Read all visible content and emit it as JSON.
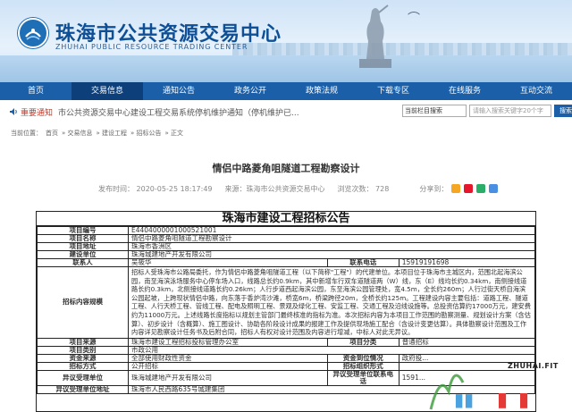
{
  "header": {
    "title": "珠海市公共资源交易中心",
    "subtitle": "ZHUHAI PUBLIC RESOURCE TRADING CENTER"
  },
  "nav": {
    "items": [
      "首页",
      "交易信息",
      "通知公告",
      "政务公开",
      "政策法规",
      "下载专区",
      "在线服务",
      "互动交流"
    ],
    "active_index": 1
  },
  "notice": {
    "label": "重要通知",
    "text": "市公共资源交易中心建设工程交易系统停机维护通知（停机维护已..."
  },
  "search": {
    "select_value": "当前栏目搜索",
    "placeholder": "请输入搜索关键字20个字",
    "button": "搜索"
  },
  "breadcrumb": [
    "当前位置：",
    "首页",
    "» 交易信息",
    "» 建设工程",
    "» 招标公告",
    "» 正文"
  ],
  "article": {
    "title": "情侣中路菱角咀隧道工程勘察设计",
    "published": "发布时间： 2020-05-25 18:17:49",
    "source": "来源：珠海市公共资源交易中心",
    "views": "浏览次数： 728",
    "share_label": "分享到："
  },
  "doc": {
    "title": "珠海市建设工程招标公告",
    "rows": [
      {
        "label": "项目编号",
        "value": "E4404000001000521001"
      },
      {
        "label": "项目名称",
        "value": "情侣中路菱角咀隧道工程勘察设计"
      },
      {
        "label": "项目地址",
        "value": "珠海市香洲区"
      },
      {
        "label": "建设单位",
        "value": "珠海城建地产开发有限公司"
      }
    ],
    "contact": {
      "label": "联系人",
      "value": "吴筱华",
      "phone_label": "联系电话",
      "phone": "15919191698"
    },
    "overview_label": "招标内容规模",
    "overview": "招标人受珠海市公路局委托，作为情侣中路菱角咀隧道工程（以下简称\"工程\"）的代建单位。本项目位于珠海市主城区内，范围北起海滨公园，南至海滨泳场服务中心停车场入口，线路总长约0.9km，其中新增车行双车道隧道两（W）线，东（E）线均长约0.34km，南侧接线道路长约0.3km，北侧接线道路长约0.26km；人行步道西起海滨公园，东至海滨公园管理处，宽4.5m，全长约260m；人行过街天桥自海滨公园起坡，上跨现状情侣中路，向东落于香炉湾沙滩，桥宽6m，桥梁跨径20m，全桥长约125m。工程建设内容主要包括：道路工程、隧道工程、人行天桥工程、管线工程、配电及照明工程、景观及绿化工程、安监工程、交通工程及沿线设施等。总投资估算约17000万元，建安费约为11000万元。上述线路长度指标以规划主管部门最终核准的指标为准。本次招标内容为本项目工作范围的勘察测量、规划设计方案（含估算）、初步设计（含概算）、施工图设计、协助各阶段设计成果的报建工作及提供现场施工配合（含设计变更估算）。具体勘察设计范围及工作内容详见勘察设计任务书及后附合同，招标人有权对设计范围及内容进行增减，中标人对此无异议。",
    "bottom_rows": [
      {
        "label": "项目来源",
        "value": "珠海市建设工程招标投标管理办公室",
        "label2": "项目分类",
        "value2": "普通招标"
      },
      {
        "label": "项目类别",
        "value": "市政公用"
      },
      {
        "label": "资金来源",
        "value": "全部使用财政性资金",
        "label2": "资金到位情况",
        "value2": "政府投..."
      },
      {
        "label": "招标方式",
        "value": "公开招标",
        "label2": "招标组织形式",
        "value2": ""
      },
      {
        "label": "异议受理单位",
        "value": "珠海城建地产开发有限公司",
        "label2": "异议受理单位联系电话",
        "value2": "1591..."
      },
      {
        "label": "异议受理单位地址",
        "value": "珠海市人民西路635号城建集团"
      }
    ]
  },
  "watermark": {
    "text": "ZHUHAI.FIT"
  },
  "colors": {
    "nav": "#1a5fa8",
    "nav_active": "#0d3f7a",
    "title": "#0e4f96",
    "notice": "#c0392b"
  }
}
